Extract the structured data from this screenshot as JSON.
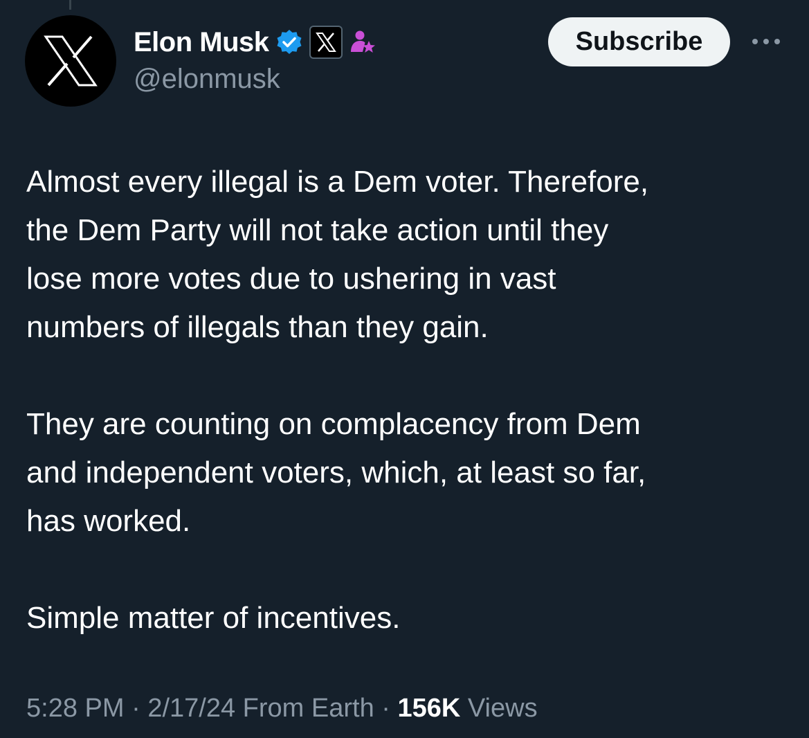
{
  "author": {
    "display_name": "Elon Musk",
    "handle": "@elonmusk",
    "avatar_icon": "x-logo-icon",
    "badges": [
      "verified-badge-icon",
      "x-affiliate-badge-icon",
      "subscriber-badge-icon"
    ]
  },
  "actions": {
    "subscribe_label": "Subscribe",
    "more_icon": "more-dots-icon"
  },
  "tweet": {
    "paragraphs": [
      [
        "Almost every illegal is a Dem voter. Therefore,",
        "the Dem Party will not take action until they",
        "lose more votes due to ushering in vast",
        "numbers of illegals than they gain."
      ],
      [
        "They are counting on complacency from Dem",
        "and independent voters, which, at least so far,",
        "has worked."
      ],
      [
        "Simple matter of incentives."
      ]
    ]
  },
  "meta": {
    "time": "5:28 PM",
    "sep1": " · ",
    "date": "2/17/24",
    "source": " From Earth",
    "sep2": " · ",
    "views_count": "156K",
    "views_label": " Views"
  },
  "colors": {
    "background": "#15202b",
    "text": "#ffffff",
    "secondary_text": "#8b98a5",
    "verified_blue": "#1d9bf0",
    "subscriber_purple": "#c94fd6",
    "button_bg": "#eff3f4"
  }
}
